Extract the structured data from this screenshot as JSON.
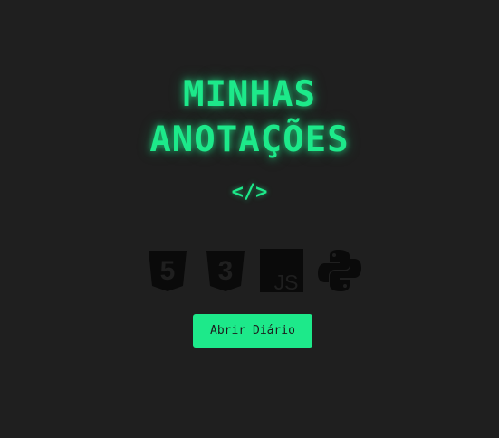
{
  "header": {
    "title_line1": "MINHAS",
    "title_line2": "ANOTAÇÕES",
    "code_symbol": "</>"
  },
  "icons": [
    {
      "name": "html5-icon",
      "label": "5"
    },
    {
      "name": "css3-icon",
      "label": "3"
    },
    {
      "name": "javascript-icon",
      "label": "JS"
    },
    {
      "name": "python-icon"
    }
  ],
  "actions": {
    "open_diary_label": "Abrir Diário"
  },
  "colors": {
    "background": "#1f1f1f",
    "accent": "#1de98a",
    "icon_fill": "#0a0a0a"
  }
}
